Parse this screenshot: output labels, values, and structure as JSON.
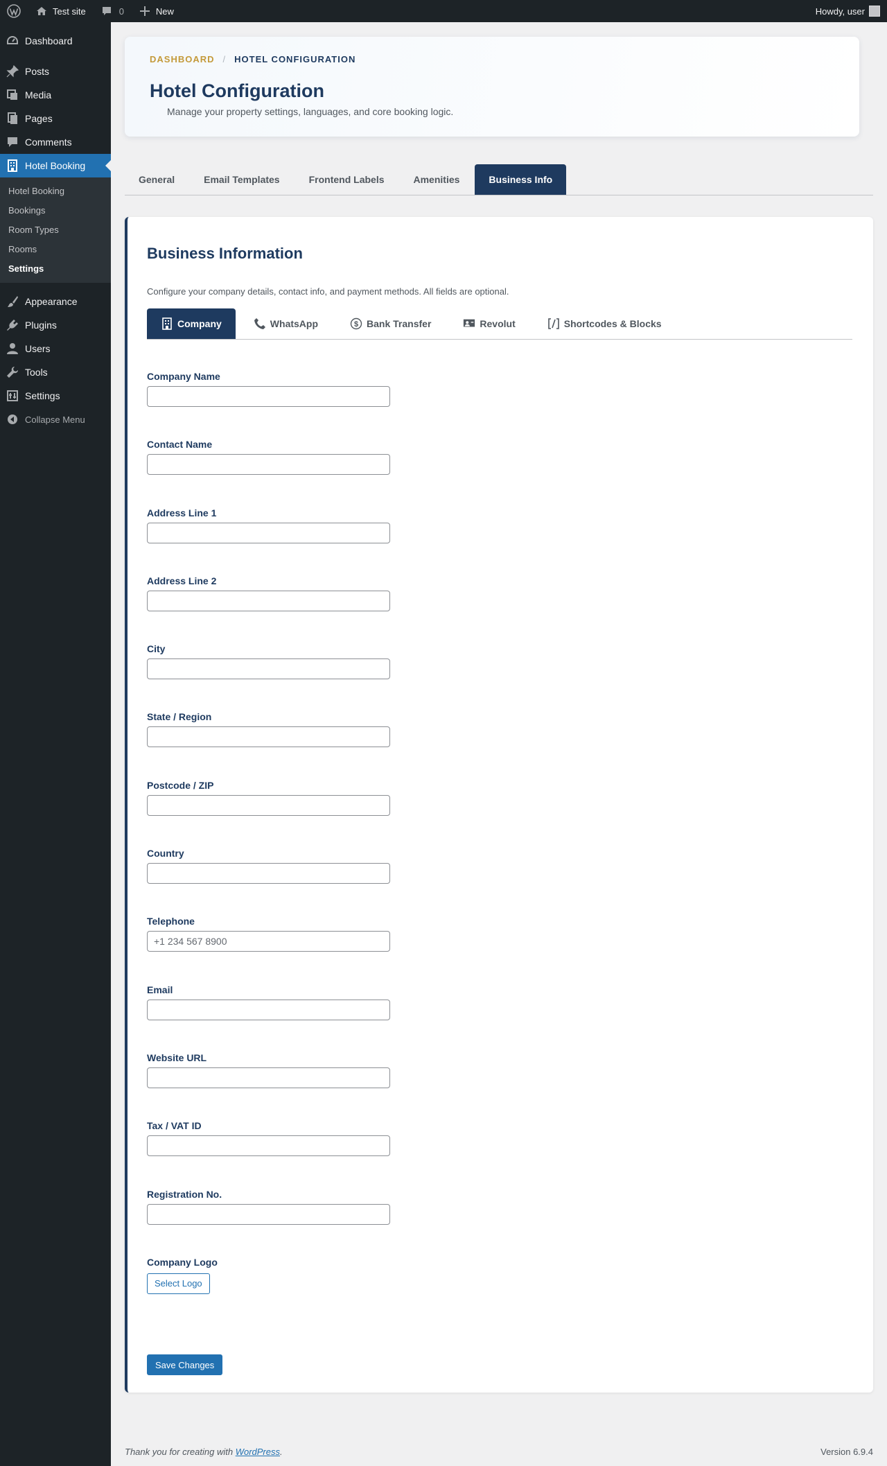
{
  "admin_bar": {
    "site_name": "Test site",
    "comments_count": "0",
    "new_label": "New",
    "howdy": "Howdy, user"
  },
  "sidebar": {
    "items_top": [
      {
        "label": "Dashboard",
        "icon": "dashboard-icon"
      },
      {
        "label": "Posts",
        "icon": "pin-icon"
      },
      {
        "label": "Media",
        "icon": "media-icon"
      },
      {
        "label": "Pages",
        "icon": "pages-icon"
      },
      {
        "label": "Comments",
        "icon": "comment-icon"
      },
      {
        "label": "Hotel Booking",
        "icon": "building-icon"
      }
    ],
    "submenu": [
      "Hotel Booking",
      "Bookings",
      "Room Types",
      "Rooms",
      "Settings"
    ],
    "items_bottom": [
      {
        "label": "Appearance",
        "icon": "paintbrush-icon"
      },
      {
        "label": "Plugins",
        "icon": "plugin-icon"
      },
      {
        "label": "Users",
        "icon": "user-icon"
      },
      {
        "label": "Tools",
        "icon": "wrench-icon"
      },
      {
        "label": "Settings",
        "icon": "settings-icon"
      }
    ],
    "collapse_label": "Collapse Menu"
  },
  "header": {
    "breadcrumb_root": "DASHBOARD",
    "breadcrumb_sep": "/",
    "breadcrumb_current": "HOTEL CONFIGURATION",
    "title": "Hotel Configuration",
    "subtitle": "Manage your property settings, languages, and core booking logic."
  },
  "main_tabs": [
    "General",
    "Email Templates",
    "Frontend Labels",
    "Amenities",
    "Business Info"
  ],
  "panel": {
    "title": "Business Information",
    "description": "Configure your company details, contact info, and payment methods. All fields are optional.",
    "sub_tabs": [
      {
        "label": "Company",
        "icon": "building-icon"
      },
      {
        "label": "WhatsApp",
        "icon": "phone-icon"
      },
      {
        "label": "Bank Transfer",
        "icon": "dollar-icon"
      },
      {
        "label": "Revolut",
        "icon": "id-card-icon"
      },
      {
        "label": "Shortcodes & Blocks",
        "icon": "shortcode-icon"
      }
    ],
    "fields": [
      {
        "label": "Company Name",
        "value": "",
        "placeholder": ""
      },
      {
        "label": "Contact Name",
        "value": "",
        "placeholder": ""
      },
      {
        "label": "Address Line 1",
        "value": "",
        "placeholder": ""
      },
      {
        "label": "Address Line 2",
        "value": "",
        "placeholder": ""
      },
      {
        "label": "City",
        "value": "",
        "placeholder": ""
      },
      {
        "label": "State / Region",
        "value": "",
        "placeholder": ""
      },
      {
        "label": "Postcode / ZIP",
        "value": "",
        "placeholder": ""
      },
      {
        "label": "Country",
        "value": "",
        "placeholder": ""
      },
      {
        "label": "Telephone",
        "value": "",
        "placeholder": "+1 234 567 8900"
      },
      {
        "label": "Email",
        "value": "",
        "placeholder": ""
      },
      {
        "label": "Website URL",
        "value": "",
        "placeholder": ""
      },
      {
        "label": "Tax / VAT ID",
        "value": "",
        "placeholder": ""
      },
      {
        "label": "Registration No.",
        "value": "",
        "placeholder": ""
      }
    ],
    "logo_label": "Company Logo",
    "logo_button": "Select Logo",
    "save_button": "Save Changes"
  },
  "footer": {
    "thanks_prefix": "Thank you for creating with ",
    "wp_link": "WordPress",
    "thanks_suffix": ".",
    "version": "Version 6.9.4"
  },
  "colors": {
    "navy": "#1e3a5f",
    "wp_blue": "#2271b1",
    "gold": "#c49a3a",
    "admin_dark": "#1d2327"
  }
}
